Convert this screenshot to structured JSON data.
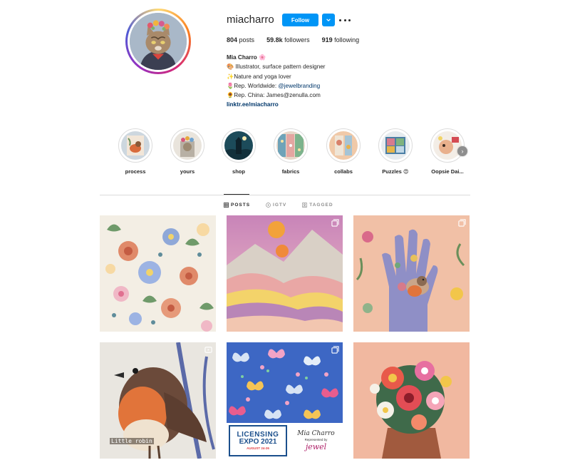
{
  "profile": {
    "username": "miacharro",
    "follow_label": "Follow",
    "stats": {
      "posts_count": "804",
      "posts_label": "posts",
      "followers_count": "59.8k",
      "followers_label": "followers",
      "following_count": "919",
      "following_label": "following"
    },
    "bio": {
      "name": "Mia Charro 🌸",
      "line1": "🎨 Illustrator, surface pattern designer",
      "line2": "✨Nature and yoga lover",
      "line3_prefix": "🌷Rep. Worldwide: ",
      "line3_mention": "@jewelbranding",
      "line4": "🌻Rep. China: James@zenulla.com",
      "link": "linktr.ee/miacharro"
    }
  },
  "highlights": [
    {
      "label": "process"
    },
    {
      "label": "yours"
    },
    {
      "label": "shop"
    },
    {
      "label": "fabrics"
    },
    {
      "label": "collabs"
    },
    {
      "label": "Puzzles 😍"
    },
    {
      "label": "Oopsie Dai..."
    }
  ],
  "tabs": [
    {
      "label": "POSTS",
      "active": true
    },
    {
      "label": "IGTV",
      "active": false
    },
    {
      "label": "TAGGED",
      "active": false
    }
  ],
  "posts": {
    "robin_caption": "Little robin",
    "expo": {
      "title_top": "LICENSING",
      "title_bottom": "EXPO 2021",
      "dates": "AUGUST 24-26",
      "signature": "Mia Charro",
      "represented": "Represented by",
      "agency": "jewel"
    }
  },
  "colors": {
    "accent": "#0095f6",
    "link": "#00376b"
  }
}
